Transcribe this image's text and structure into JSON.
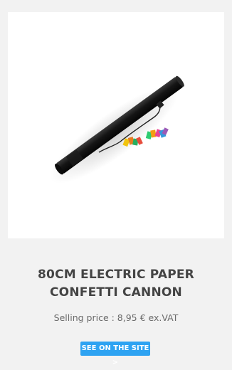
{
  "product": {
    "title_line1": "80CM ELECTRIC PAPER",
    "title_line2": "CONFETTI CANNON",
    "price_text": "Selling price : 8,95 € ex.VAT",
    "cta_label": "SEE ON THE SITE  >"
  },
  "colors": {
    "background": "#f2f2f2",
    "image_bg": "#ffffff",
    "title": "#444444",
    "price": "#6a6a6a",
    "button": "#2ea3f2"
  }
}
